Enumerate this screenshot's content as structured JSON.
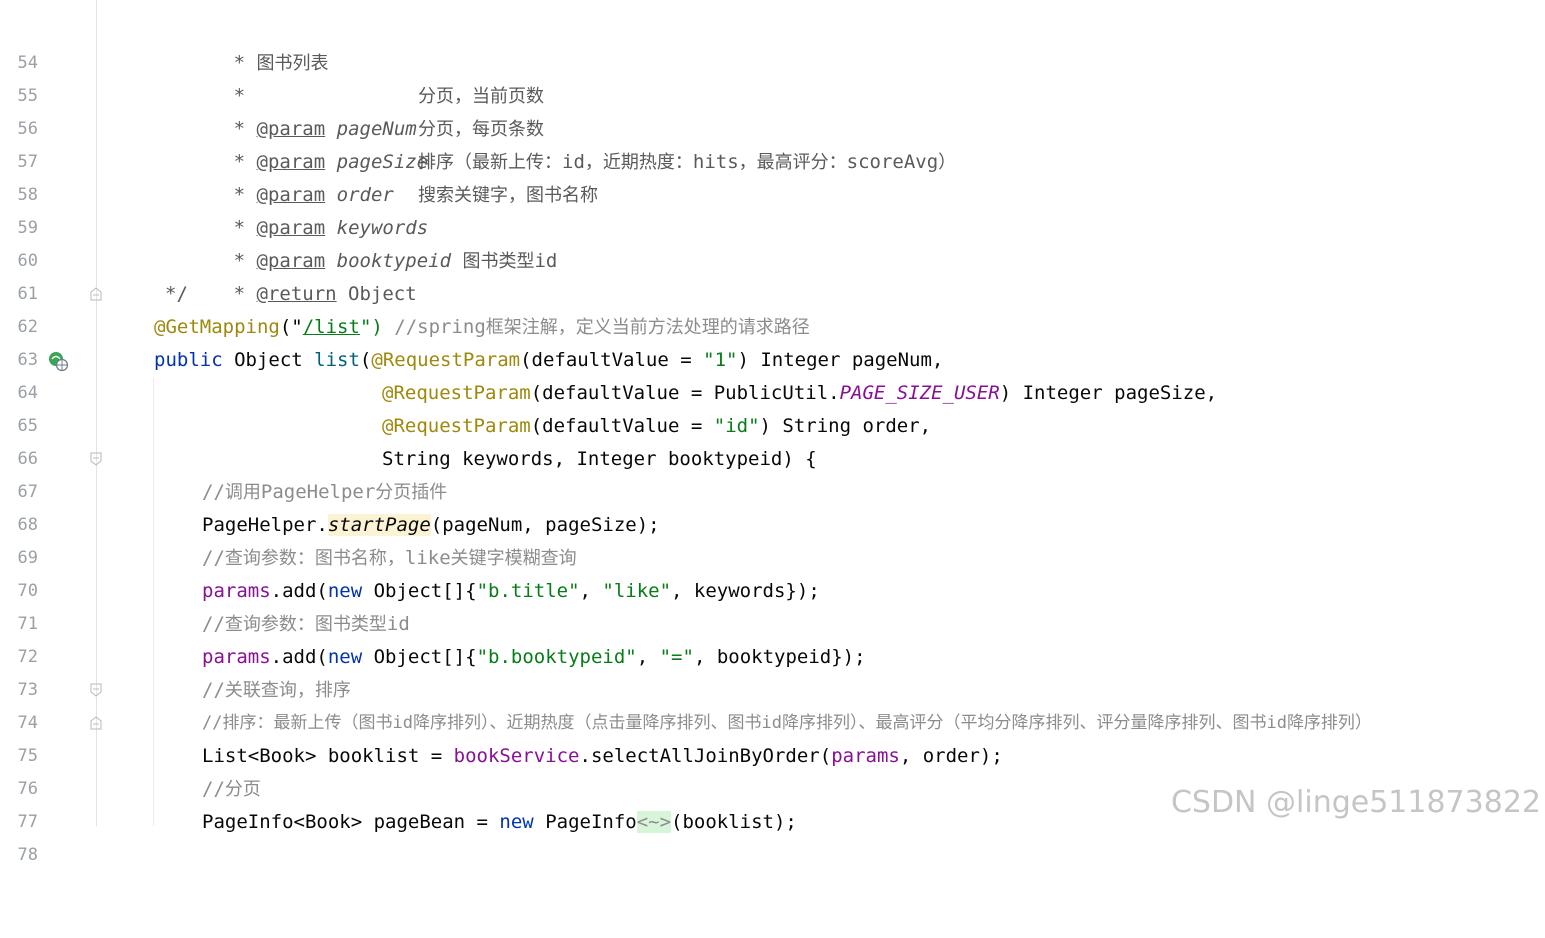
{
  "watermark": "CSDN @linge511873822",
  "lines": [
    {
      "no": "54"
    },
    {
      "no": "55"
    },
    {
      "no": "56"
    },
    {
      "no": "57"
    },
    {
      "no": "58"
    },
    {
      "no": "59"
    },
    {
      "no": "60"
    },
    {
      "no": "61"
    },
    {
      "no": "62"
    },
    {
      "no": "63"
    },
    {
      "no": "64"
    },
    {
      "no": "65"
    },
    {
      "no": "66"
    },
    {
      "no": "67"
    },
    {
      "no": "68"
    },
    {
      "no": "69"
    },
    {
      "no": "70"
    },
    {
      "no": "71"
    },
    {
      "no": "72"
    },
    {
      "no": "73"
    },
    {
      "no": "74"
    },
    {
      "no": "75"
    },
    {
      "no": "76"
    },
    {
      "no": "77"
    },
    {
      "no": "78"
    }
  ],
  "code": {
    "l54": {
      "star": "* ",
      "text": "图书列表"
    },
    "l55": {
      "star": "*"
    },
    "l56": {
      "star": "* ",
      "tag": "@param",
      "name": "pageNum",
      "desc": "分页，当前页数"
    },
    "l57": {
      "star": "* ",
      "tag": "@param",
      "name": "pageSize",
      "desc": "分页，每页条数"
    },
    "l58": {
      "star": "* ",
      "tag": "@param",
      "name": "order",
      "desc_a": "排序（最新上传：",
      "d1": "id",
      "desc_b": "，近期热度：",
      "d2": "hits",
      "desc_c": "，最高评分：",
      "d3": "scoreAvg",
      "desc_d": "）"
    },
    "l59": {
      "star": "* ",
      "tag": "@param",
      "name": "keywords",
      "desc": "搜索关键字，图书名称"
    },
    "l60": {
      "star": "* ",
      "tag": "@param",
      "name": "booktypeid",
      "desc_a": "图书类型",
      "d1": "id"
    },
    "l61": {
      "star": "* ",
      "tag": "@return",
      "rest": " Object"
    },
    "l62": {
      "text": "*/"
    },
    "l63": {
      "ann": "@GetMapping",
      "p1": "(\"",
      "path": "/list",
      "p2": "\")",
      "c1": " //spring",
      "c2": "框架注解，定义当前方法处理的请求路径"
    },
    "l64": {
      "kw": "public",
      "t1": " Object ",
      "m": "list",
      "p": "(",
      "ann": "@RequestParam",
      "t2": "(defaultValue = ",
      "s": "\"1\"",
      "t3": ") Integer pageNum,"
    },
    "l65": {
      "ann": "@RequestParam",
      "t1": "(defaultValue = PublicUtil.",
      "c": "PAGE_SIZE_USER",
      "t2": ") Integer pageSize,"
    },
    "l66": {
      "ann": "@RequestParam",
      "t1": "(defaultValue = ",
      "s": "\"id\"",
      "t2": ") String order,"
    },
    "l67": {
      "t": "String keywords, Integer booktypeid) {"
    },
    "l68": {
      "c1": "//",
      "c2": "调用",
      "c3": "PageHelper",
      "c4": "分页插件"
    },
    "l69": {
      "t1": "PageHelper.",
      "m": "startPage",
      "t2": "(pageNum, pageSize);"
    },
    "l70": {
      "c1": "//",
      "c2": "查询参数：图书名称，",
      "c3": "like",
      "c4": "关键字模糊查询"
    },
    "l71": {
      "f": "params",
      "t1": ".add(",
      "kw": "new",
      "t2": " Object[]{",
      "s1": "\"b.title\"",
      "t3": ", ",
      "s2": "\"like\"",
      "t4": ", keywords});"
    },
    "l72": {
      "c1": "//",
      "c2": "查询参数：图书类型",
      "c3": "id"
    },
    "l73": {
      "f": "params",
      "t1": ".add(",
      "kw": "new",
      "t2": " Object[]{",
      "s1": "\"b.booktypeid\"",
      "t3": ", ",
      "s2": "\"=\"",
      "t4": ", booktypeid});"
    },
    "l74": {
      "c1": "//",
      "c2": "关联查询，排序"
    },
    "l75": {
      "c1": "//",
      "c2": "排序：最新上传（图书",
      "c3": "id",
      "c4": "降序排列）、近期热度（点击量降序排列、图书",
      "c5": "id",
      "c6": "降序排列）、最高评分（平均分降序排列、评分量降序排列、图书",
      "c7": "id",
      "c8": "降序排列）"
    },
    "l76": {
      "t1": "List<Book> booklist = ",
      "f1": "bookService",
      "t2": ".selectAllJoinByOrder(",
      "f2": "params",
      "t3": ", order);"
    },
    "l77": {
      "c1": "//",
      "c2": "分页"
    },
    "l78": {
      "t1": "PageInfo<Book> pageBean = ",
      "kw": "new",
      "t2": " PageInfo",
      "h": "<~>",
      "t3": "(booklist);"
    }
  }
}
